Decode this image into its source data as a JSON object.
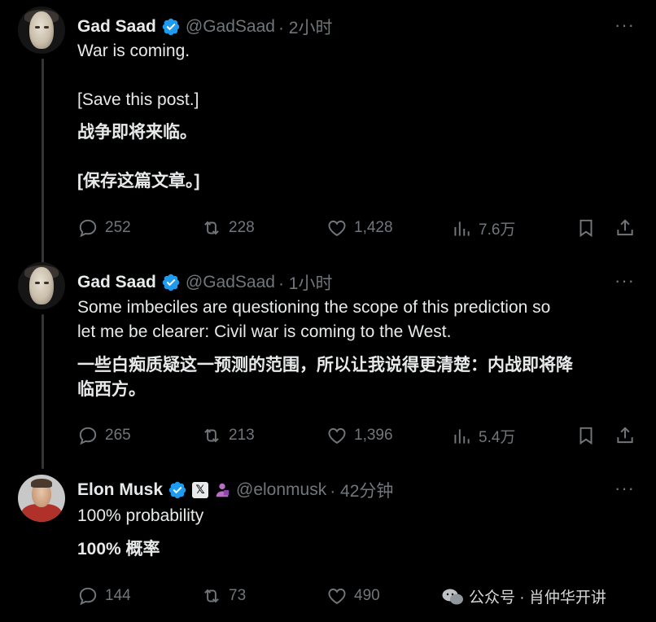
{
  "posts": [
    {
      "name": "Gad Saad",
      "handle": "@GadSaad",
      "time": "· 2小时",
      "body_en": "War is coming.\n\n[Save this post.]",
      "body_zh": "战争即将来临。\n\n[保存这篇文章。]",
      "replies": "252",
      "reposts": "228",
      "likes": "1,428",
      "views": "7.6万",
      "more": "···"
    },
    {
      "name": "Gad Saad",
      "handle": "@GadSaad",
      "time": "· 1小时",
      "body_en": "Some imbeciles are questioning the scope of this prediction so\nlet me be clearer:  Civil war is coming to the West.",
      "body_zh": "一些白痴质疑这一预测的范围，所以让我说得更清楚：内战即将降\n临西方。",
      "replies": "265",
      "reposts": "213",
      "likes": "1,396",
      "views": "5.4万",
      "more": "···"
    },
    {
      "name": "Elon Musk",
      "x_badge": "𝕏",
      "handle": "@elonmusk",
      "time": "· 42分钟",
      "body_en": "100% probability",
      "body_zh": "100% 概率",
      "replies": "144",
      "reposts": "73",
      "likes": "490",
      "more": "···"
    }
  ],
  "watermark": {
    "text": "公众号 · 肖仲华开讲"
  },
  "icons": {
    "verified": "verified-badge-icon",
    "reply": "reply-icon",
    "repost": "repost-icon",
    "like": "heart-icon",
    "views": "views-chart-icon",
    "bookmark": "bookmark-icon",
    "share": "share-icon"
  },
  "colors": {
    "background": "#000000",
    "text": "#e7e9ea",
    "muted": "#71767b",
    "verified": "#1d9bf0",
    "avatar_shirt": "#b0302a"
  }
}
